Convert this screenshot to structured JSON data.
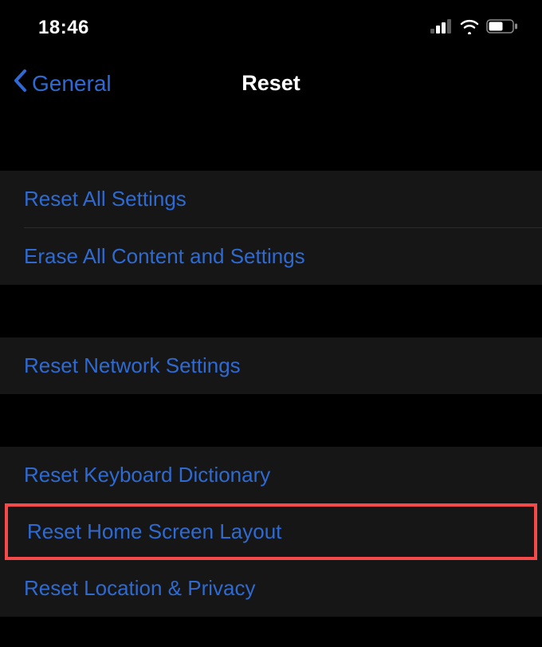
{
  "status_bar": {
    "time": "18:46"
  },
  "nav": {
    "back_label": "General",
    "title": "Reset"
  },
  "groups": [
    {
      "items": [
        {
          "label": "Reset All Settings"
        },
        {
          "label": "Erase All Content and Settings"
        }
      ]
    },
    {
      "items": [
        {
          "label": "Reset Network Settings"
        }
      ]
    },
    {
      "items": [
        {
          "label": "Reset Keyboard Dictionary"
        },
        {
          "label": "Reset Home Screen Layout",
          "highlighted": true
        },
        {
          "label": "Reset Location & Privacy"
        }
      ]
    }
  ]
}
